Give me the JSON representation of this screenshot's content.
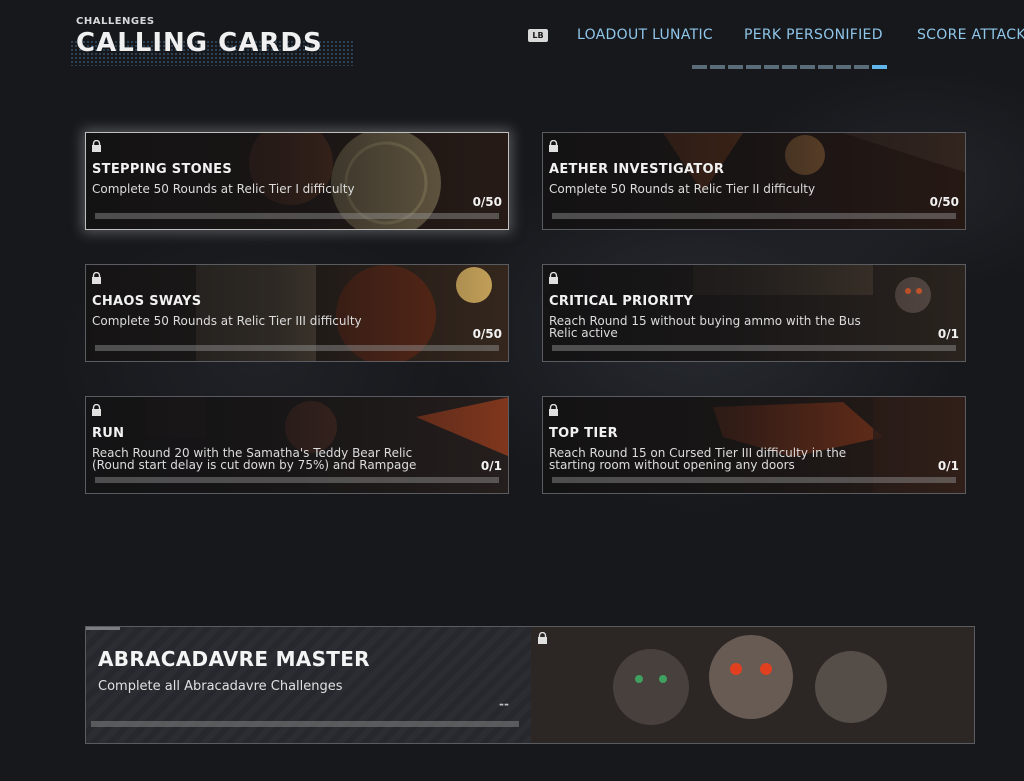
{
  "header": {
    "section": "CHALLENGES",
    "title": "CALLING CARDS",
    "lb_badge": "LB"
  },
  "tabs": [
    {
      "label": "LOADOUT LUNATIC"
    },
    {
      "label": "PERK PERSONIFIED"
    },
    {
      "label": "SCORE ATTACK"
    }
  ],
  "pager": {
    "total": 11,
    "active_index": 10
  },
  "cards": [
    {
      "title": "STEPPING STONES",
      "desc": "Complete 50 Rounds at Relic Tier I difficulty",
      "progress": "0/50",
      "fraction": 0,
      "selected": true,
      "art_color": "#3a2a20"
    },
    {
      "title": "AETHER INVESTIGATOR",
      "desc": "Complete 50 Rounds at Relic Tier II difficulty",
      "progress": "0/50",
      "fraction": 0,
      "selected": false,
      "art_color": "#4a2a18"
    },
    {
      "title": "CHAOS SWAYS",
      "desc": "Complete 50 Rounds at Relic Tier III difficulty",
      "progress": "0/50",
      "fraction": 0,
      "selected": false,
      "art_color": "#5a3a24"
    },
    {
      "title": "CRITICAL PRIORITY",
      "desc": "Reach Round 15 without buying ammo with the Bus Relic active",
      "progress": "0/1",
      "fraction": 0,
      "selected": false,
      "art_color": "#3a2e26"
    },
    {
      "title": "RUN",
      "desc": "Reach Round 20 with the Samatha's Teddy Bear Relic (Round start delay is cut down by 75%) and Rampage",
      "progress": "0/1",
      "fraction": 0,
      "selected": false,
      "art_color": "#3a2a28"
    },
    {
      "title": "TOP TIER",
      "desc": "Reach Round 15 on Cursed Tier III difficulty in the starting room without opening any doors",
      "progress": "0/1",
      "fraction": 0,
      "selected": false,
      "art_color": "#4a2a1a"
    }
  ],
  "master": {
    "title": "ABRACADAVRE MASTER",
    "desc": "Complete all Abracadavre Challenges",
    "progress": "--"
  },
  "colors": {
    "accent": "#8fc6ea",
    "pager_active": "#5fb5ea",
    "background": "#16181c"
  }
}
